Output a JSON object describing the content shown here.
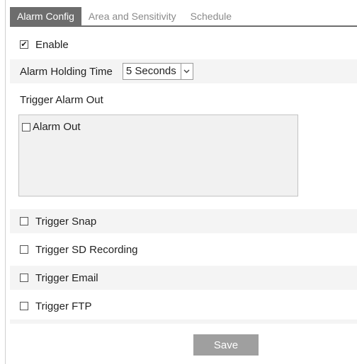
{
  "tabs": [
    {
      "label": "Alarm Config",
      "active": true
    },
    {
      "label": "Area and Sensitivity",
      "active": false
    },
    {
      "label": "Schedule",
      "active": false
    }
  ],
  "enable": {
    "label": "Enable",
    "checked": true
  },
  "alarm_holding_time": {
    "label": "Alarm Holding Time",
    "value": "5 Seconds"
  },
  "trigger_alarm_out": {
    "label": "Trigger Alarm Out",
    "items": [
      {
        "label": "Alarm Out",
        "checked": false
      }
    ]
  },
  "triggers": [
    {
      "label": "Trigger Snap",
      "checked": false
    },
    {
      "label": "Trigger SD Recording",
      "checked": false
    },
    {
      "label": "Trigger Email",
      "checked": false
    },
    {
      "label": "Trigger FTP",
      "checked": false
    }
  ],
  "save_label": "Save",
  "check_glyph": "✔",
  "colors": {
    "tab_active": "#6d6d6d",
    "tab_inactive_text": "#8a8a8a",
    "row_shade": "#f4f4f4",
    "save_button": "#9f9f9f"
  }
}
